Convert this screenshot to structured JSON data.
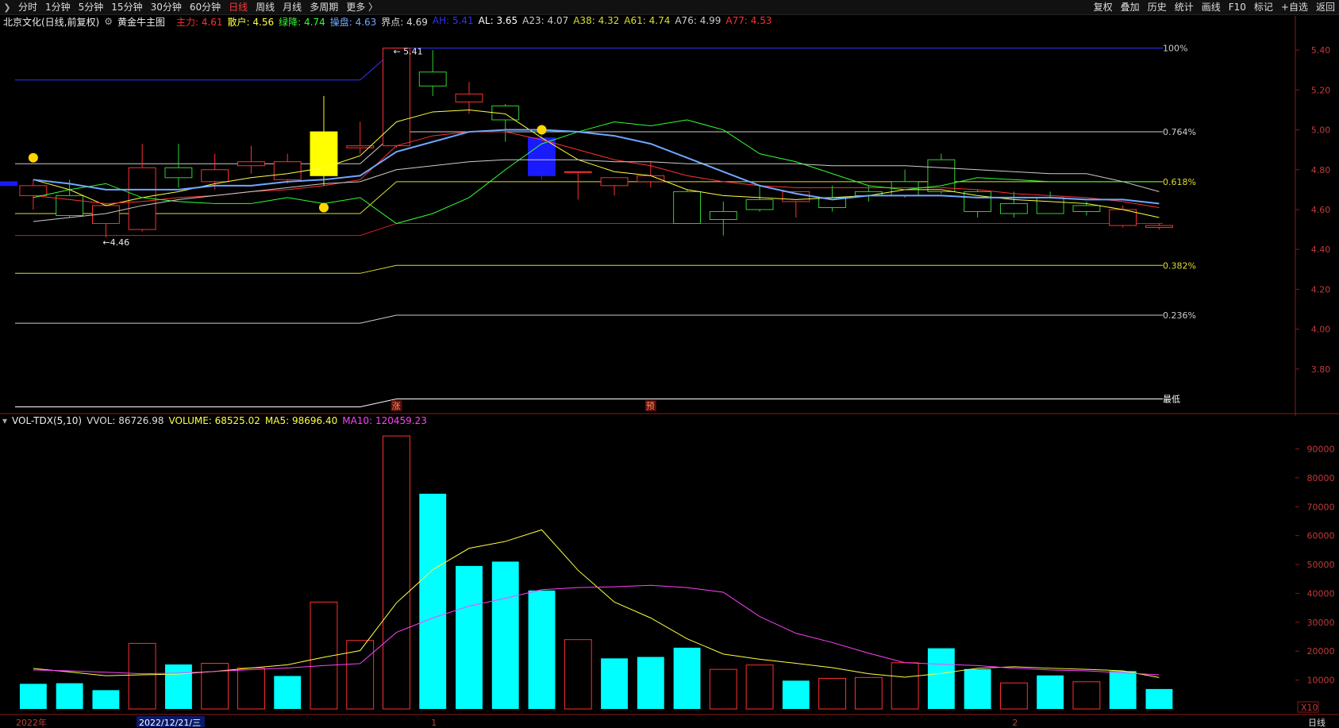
{
  "toolbar": {
    "left": [
      "分时",
      "1分钟",
      "5分钟",
      "15分钟",
      "30分钟",
      "60分钟",
      "日线",
      "周线",
      "月线",
      "多周期",
      "更多 〉"
    ],
    "active": "日线",
    "right": [
      "复权",
      "叠加",
      "历史",
      "统计",
      "画线",
      "F10",
      "标记",
      "+自选",
      "返回"
    ]
  },
  "main_legend": {
    "stock": "北京文化(日线,前复权)",
    "indicator": "黄金牛主图",
    "items": [
      {
        "label": "主力",
        "value": "4.61",
        "color": "#ff3030"
      },
      {
        "label": "散户",
        "value": "4.56",
        "color": "#ffff40"
      },
      {
        "label": "绿降",
        "value": "4.74",
        "color": "#30ff30"
      },
      {
        "label": "操盘",
        "value": "4.63",
        "color": "#6fa8ff"
      },
      {
        "label": "界点",
        "value": "4.69",
        "color": "#dddddd"
      },
      {
        "label": "AH",
        "value": "5.41",
        "color": "#3030ff"
      },
      {
        "label": "AL",
        "value": "3.65",
        "color": "#ffffff"
      },
      {
        "label": "A23",
        "value": "4.07",
        "color": "#cccccc"
      },
      {
        "label": "A38",
        "value": "4.32",
        "color": "#dddd30"
      },
      {
        "label": "A61",
        "value": "4.74",
        "color": "#dddd30"
      },
      {
        "label": "A76",
        "value": "4.99",
        "color": "#cccccc"
      },
      {
        "label": "A77",
        "value": "4.53",
        "color": "#ff3030"
      }
    ]
  },
  "vol_legend": {
    "name": "VOL-TDX(5,10)",
    "items": [
      {
        "label": "VVOL",
        "value": "86726.98",
        "color": "#dddddd"
      },
      {
        "label": "VOLUME",
        "value": "68525.02",
        "color": "#ffff40"
      },
      {
        "label": "MA5",
        "value": "98696.40",
        "color": "#ffff40"
      },
      {
        "label": "MA10",
        "value": "120459.23",
        "color": "#ff40ff"
      }
    ]
  },
  "chart_data": [
    {
      "type": "candlestick",
      "ylim": [
        3.62,
        5.52
      ],
      "yticks": [
        "5.40",
        "5.20",
        "5.00",
        "4.80",
        "4.60",
        "4.40",
        "4.20",
        "4.00",
        "3.80"
      ],
      "ohlc": [
        [
          4.67,
          4.75,
          4.6,
          4.72
        ],
        [
          4.67,
          4.75,
          4.56,
          4.57
        ],
        [
          4.53,
          4.63,
          4.46,
          4.62
        ],
        [
          4.5,
          4.93,
          4.49,
          4.81
        ],
        [
          4.81,
          4.93,
          4.71,
          4.76
        ],
        [
          4.74,
          4.88,
          4.7,
          4.8
        ],
        [
          4.82,
          4.92,
          4.78,
          4.84
        ],
        [
          4.75,
          4.88,
          4.73,
          4.84
        ],
        [
          4.77,
          5.17,
          4.72,
          4.99
        ],
        [
          4.91,
          5.04,
          4.88,
          4.92
        ],
        [
          4.92,
          5.41,
          4.91,
          5.41
        ],
        [
          5.29,
          5.4,
          5.17,
          5.22
        ],
        [
          5.14,
          5.24,
          5.08,
          5.18
        ],
        [
          5.12,
          5.13,
          4.94,
          5.05
        ],
        [
          4.96,
          4.99,
          4.75,
          4.77
        ],
        [
          4.79,
          4.79,
          4.65,
          4.79
        ],
        [
          4.72,
          4.76,
          4.67,
          4.76
        ],
        [
          4.74,
          4.84,
          4.71,
          4.77
        ],
        [
          4.69,
          4.7,
          4.53,
          4.53
        ],
        [
          4.59,
          4.64,
          4.47,
          4.55
        ],
        [
          4.65,
          4.72,
          4.59,
          4.6
        ],
        [
          4.64,
          4.67,
          4.56,
          4.69
        ],
        [
          4.66,
          4.72,
          4.59,
          4.61
        ],
        [
          4.69,
          4.72,
          4.64,
          4.67
        ],
        [
          4.74,
          4.8,
          4.66,
          4.67
        ],
        [
          4.85,
          4.88,
          4.68,
          4.69
        ],
        [
          4.69,
          4.7,
          4.56,
          4.59
        ],
        [
          4.63,
          4.69,
          4.56,
          4.58
        ],
        [
          4.66,
          4.69,
          4.58,
          4.58
        ],
        [
          4.62,
          4.64,
          4.57,
          4.59
        ],
        [
          4.52,
          4.62,
          4.51,
          4.6
        ],
        [
          4.51,
          4.53,
          4.5,
          4.52
        ]
      ],
      "fib_levels": [
        {
          "label": "100%",
          "value": 5.41,
          "color": "#3333ff"
        },
        {
          "label": "0.764%",
          "value": 4.99,
          "color": "#cccccc"
        },
        {
          "label": "0.618%",
          "value": 4.74,
          "color": "#dddd30"
        },
        {
          "label": "0.382%",
          "value": 4.32,
          "color": "#dddd30"
        },
        {
          "label": "0.236%",
          "value": 4.07,
          "color": "#cccccc"
        },
        {
          "label": "最低",
          "value": 3.65,
          "color": "#ffffff"
        }
      ],
      "annotations": [
        {
          "text": "← 5.41",
          "index": 10
        },
        {
          "text": "←4.46",
          "index": 2
        },
        {
          "text": "涨",
          "index": 10
        },
        {
          "text": "预",
          "index": 17
        }
      ],
      "series": [
        {
          "color": "#ffff40",
          "values": [
            4.75,
            4.7,
            4.62,
            4.66,
            4.69,
            4.73,
            4.76,
            4.78,
            4.81,
            4.87,
            5.04,
            5.09,
            5.1,
            5.08,
            4.96,
            4.85,
            4.79,
            4.77,
            4.7,
            4.67,
            4.66,
            4.65,
            4.66,
            4.67,
            4.7,
            4.7,
            4.67,
            4.65,
            4.64,
            4.63,
            4.6,
            4.56
          ]
        },
        {
          "color": "#ff3030",
          "values": [
            4.67,
            4.65,
            4.63,
            4.64,
            4.66,
            4.67,
            4.69,
            4.7,
            4.72,
            4.75,
            4.92,
            4.97,
            4.99,
            4.99,
            4.95,
            4.9,
            4.85,
            4.82,
            4.77,
            4.74,
            4.72,
            4.71,
            4.71,
            4.71,
            4.71,
            4.71,
            4.7,
            4.68,
            4.67,
            4.66,
            4.64,
            4.61
          ]
        },
        {
          "color": "#30ff30",
          "values": [
            4.66,
            4.7,
            4.73,
            4.66,
            4.64,
            4.63,
            4.63,
            4.66,
            4.63,
            4.66,
            4.53,
            4.58,
            4.66,
            4.8,
            4.93,
            4.99,
            5.04,
            5.02,
            5.05,
            5.0,
            4.88,
            4.84,
            4.78,
            4.72,
            4.7,
            4.72,
            4.76,
            4.75,
            4.74,
            4.74,
            4.74,
            4.74
          ]
        },
        {
          "color": "#6fa8ff",
          "values": [
            4.75,
            4.73,
            4.7,
            4.7,
            4.7,
            4.72,
            4.72,
            4.74,
            4.75,
            4.77,
            4.89,
            4.94,
            4.99,
            5.0,
            5.0,
            4.99,
            4.97,
            4.93,
            4.86,
            4.79,
            4.72,
            4.68,
            4.65,
            4.67,
            4.67,
            4.67,
            4.66,
            4.66,
            4.66,
            4.65,
            4.65,
            4.63
          ]
        },
        {
          "color": "#cccccc",
          "values": [
            4.54,
            4.56,
            4.58,
            4.62,
            4.65,
            4.67,
            4.69,
            4.71,
            4.73,
            4.74,
            4.8,
            4.82,
            4.84,
            4.85,
            4.85,
            4.85,
            4.84,
            4.84,
            4.83,
            4.83,
            4.83,
            4.83,
            4.82,
            4.82,
            4.82,
            4.81,
            4.8,
            4.79,
            4.78,
            4.78,
            4.74,
            4.69
          ]
        }
      ]
    },
    {
      "type": "bar",
      "ylim": [
        0,
        97000
      ],
      "yticks": [
        "90000",
        "80000",
        "70000",
        "60000",
        "50000",
        "40000",
        "30000",
        "20000",
        "10000"
      ],
      "unit_label": "X10",
      "xlabels": [
        {
          "text": "2022年",
          "index": 0
        },
        {
          "text": "2022/12/21/三",
          "index": 4
        },
        {
          "text": "1",
          "index": 11
        },
        {
          "text": "2",
          "index": 27
        }
      ],
      "period_label": "日线",
      "values": [
        8700,
        8900,
        6500,
        22700,
        15400,
        15800,
        14200,
        11400,
        37000,
        23700,
        94500,
        74500,
        49500,
        51000,
        41000,
        24000,
        17500,
        18000,
        21200,
        13700,
        15200,
        9800,
        10600,
        10900,
        16000,
        21000,
        13800,
        9000,
        11600,
        9400,
        13100,
        6900
      ],
      "up": [
        false,
        false,
        false,
        true,
        false,
        true,
        true,
        false,
        true,
        true,
        true,
        false,
        false,
        false,
        false,
        true,
        false,
        false,
        false,
        true,
        true,
        false,
        true,
        true,
        true,
        false,
        false,
        true,
        false,
        true,
        false,
        false
      ],
      "series": [
        {
          "color": "#ffff40",
          "values": [
            14000,
            12800,
            11500,
            11800,
            12100,
            13000,
            14200,
            15300,
            17900,
            20200,
            36700,
            48200,
            55600,
            58000,
            62000,
            48000,
            37000,
            31500,
            24300,
            19000,
            17200,
            15800,
            14300,
            12200,
            11000,
            12300,
            14100,
            14600,
            14100,
            13700,
            13200,
            10900
          ]
        },
        {
          "color": "#ff40ff",
          "values": [
            13500,
            13200,
            12700,
            12200,
            12400,
            13000,
            13600,
            14200,
            15000,
            15700,
            26500,
            31500,
            35600,
            38300,
            41300,
            42000,
            42300,
            42800,
            42000,
            40400,
            32000,
            26200,
            23000,
            19300,
            16000,
            15500,
            15000,
            14100,
            13500,
            13200,
            12500,
            11800
          ]
        }
      ]
    }
  ]
}
